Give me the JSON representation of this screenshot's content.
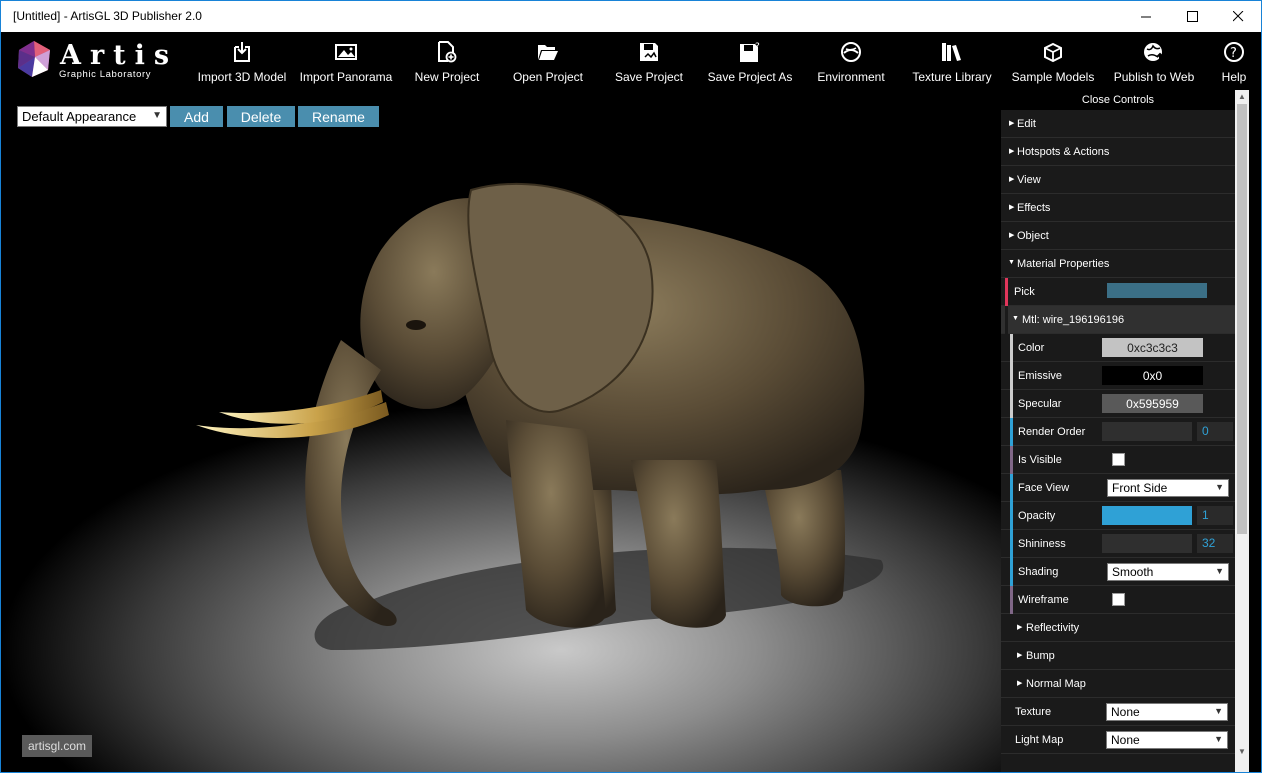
{
  "window": {
    "title": "[Untitled] - ArtisGL 3D Publisher 2.0",
    "minimize": "—",
    "maximize": "☐",
    "close": "✕"
  },
  "logo": {
    "word": "Artis",
    "subtitle": "Graphic Laboratory"
  },
  "toolbar": [
    {
      "label": "Import 3D Model",
      "icon": "import-model-icon"
    },
    {
      "label": "Import Panorama",
      "icon": "panorama-icon"
    },
    {
      "label": "New Project",
      "icon": "new-project-icon"
    },
    {
      "label": "Open Project",
      "icon": "folder-open-icon"
    },
    {
      "label": "Save Project",
      "icon": "save-icon"
    },
    {
      "label": "Save Project As",
      "icon": "save-as-icon"
    },
    {
      "label": "Environment",
      "icon": "environment-icon"
    },
    {
      "label": "Texture Library",
      "icon": "texture-library-icon"
    },
    {
      "label": "Sample Models",
      "icon": "sample-models-icon"
    },
    {
      "label": "Publish to Web",
      "icon": "publish-web-icon"
    },
    {
      "label": "Help",
      "icon": "help-icon"
    }
  ],
  "viewport": {
    "appearance_select": "Default Appearance",
    "add": "Add",
    "delete": "Delete",
    "rename": "Rename",
    "watermark": "artisgl.com"
  },
  "panel": {
    "close_controls": "Close Controls",
    "folders": [
      "Edit",
      "Hotspots & Actions",
      "View",
      "Effects",
      "Object",
      "Material Properties"
    ],
    "pick_label": "Pick",
    "material_folder": "Mtl: wire_196196196",
    "color": {
      "label": "Color",
      "value": "0xc3c3c3",
      "swatch": "#c3c3c3"
    },
    "emissive": {
      "label": "Emissive",
      "value": "0x0",
      "swatch": "#000000"
    },
    "specular": {
      "label": "Specular",
      "value": "0x595959",
      "swatch": "#595959"
    },
    "render_order": {
      "label": "Render Order",
      "value": "0"
    },
    "is_visible": {
      "label": "Is Visible"
    },
    "face_view": {
      "label": "Face View",
      "value": "Front Side"
    },
    "opacity": {
      "label": "Opacity",
      "value": "1",
      "fraction": 1.0
    },
    "shininess": {
      "label": "Shininess",
      "value": "32",
      "fraction": 0.0
    },
    "shading": {
      "label": "Shading",
      "value": "Smooth"
    },
    "wireframe": {
      "label": "Wireframe"
    },
    "subfolders": [
      "Reflectivity",
      "Bump",
      "Normal Map"
    ],
    "texture": {
      "label": "Texture",
      "value": "None"
    },
    "light_map": {
      "label": "Light Map",
      "value": "None"
    }
  },
  "colors": {
    "accent": "#2fa1d6",
    "button": "#4a8eae",
    "pick_bar": "#3b6f86"
  }
}
